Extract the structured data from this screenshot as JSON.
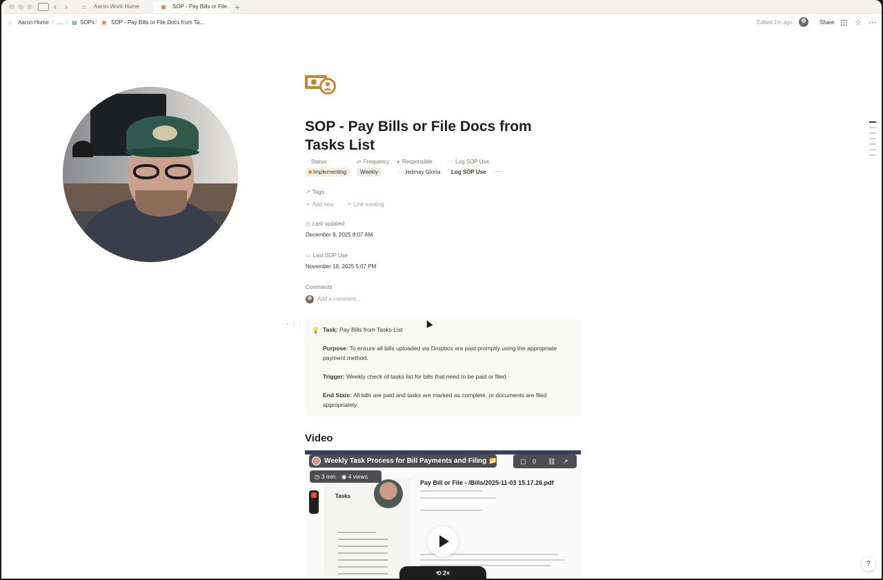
{
  "browser": {
    "tabs": [
      {
        "label": "Aaron Work Home",
        "icon": "house-icon"
      },
      {
        "label": "SOP - Pay Bills or File...",
        "icon": "money-icon"
      }
    ]
  },
  "breadcrumb": {
    "home": "Aaron Home",
    "ellipsis": "...",
    "parent": "SOPs",
    "current": "SOP - Pay Bills or File Docs from Ta..."
  },
  "topbar": {
    "edited": "Edited 1m ago",
    "share": "Share"
  },
  "page": {
    "title": "SOP - Pay Bills or File Docs from Tasks List",
    "properties": {
      "status_label": "Status",
      "status_value": "Implementing",
      "frequency_label": "Frequency",
      "frequency_value": "Weekly",
      "responsible_label": "Responsible",
      "responsible_value": "Jedmay Gloria",
      "log_label": "Log SOP Use",
      "log_button": "Log SOP Use",
      "more": "···"
    },
    "tags": {
      "label": "Tags",
      "add_new": "Add new",
      "link_existing": "Link existing"
    },
    "last_updated": {
      "label": "Last updated",
      "value": "December 9, 2025 8:07 AM"
    },
    "last_sop_use": {
      "label": "Last SOP Use",
      "value": "November 18, 2025 5:07 PM"
    },
    "comments": {
      "label": "Comments",
      "placeholder": "Add a comment..."
    },
    "callout": {
      "task_label": "Task:",
      "task_value": "Pay Bills from Tasks List",
      "purpose_label": "Purpose",
      "purpose_value": ": To ensure all bills uploaded via Dropbox are paid promptly using the appropriate payment method.",
      "trigger_label": "Trigger:",
      "trigger_value": "Weekly check of tasks list for bills that need to be paid or filed.",
      "endstate_label": "End State:",
      "endstate_value": "All bills are paid and tasks are marked as complete, or documents are filed appropriately."
    },
    "video_heading": "Video",
    "video": {
      "title": "Weekly Task Process for Bill Payments and Filing 📁",
      "duration": "3 min",
      "views": "4 views",
      "comments_count": "0",
      "doc_title": "Pay Bill or File - /Bills/2025-11-03 15.17.26.pdf",
      "sidebar_heading": "Tasks",
      "speed": "2×"
    }
  },
  "help": "?"
}
